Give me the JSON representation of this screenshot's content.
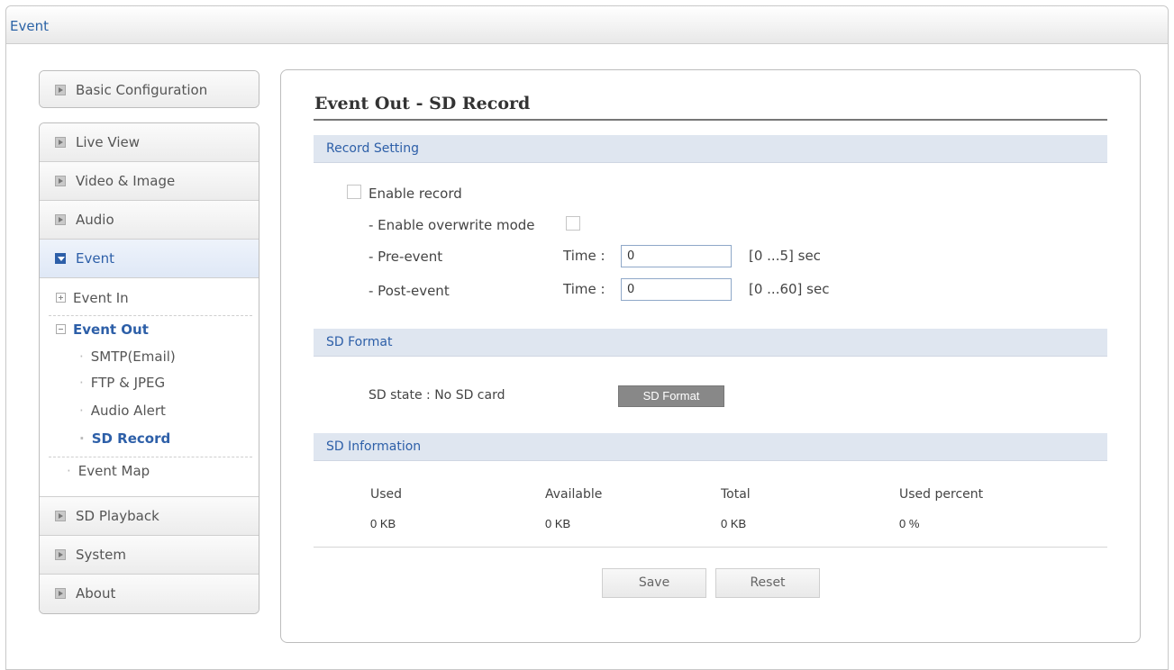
{
  "window": {
    "title": "Event"
  },
  "sidebar": {
    "top_item": "Basic Configuration",
    "items_before": [
      "Live View",
      "Video & Image",
      "Audio"
    ],
    "active_item": "Event",
    "submenu": {
      "event_in": "Event In",
      "event_out": "Event Out",
      "event_out_children": [
        "SMTP(Email)",
        "FTP & JPEG",
        "Audio Alert",
        "SD Record"
      ],
      "event_map": "Event Map"
    },
    "items_after": [
      "SD Playback",
      "System",
      "About"
    ]
  },
  "main": {
    "heading": "Event Out - SD Record",
    "record_setting": {
      "title": "Record Setting",
      "enable_record_label": "Enable record",
      "enable_record_checked": false,
      "overwrite_label": "- Enable overwrite mode",
      "overwrite_checked": false,
      "pre_event_label": "- Pre-event",
      "pre_event_time_label": "Time :",
      "pre_event_value": "0",
      "pre_event_range": "[0 ...5] sec",
      "post_event_label": "- Post-event",
      "post_event_time_label": "Time :",
      "post_event_value": "0",
      "post_event_range": "[0 ...60] sec"
    },
    "sd_format": {
      "title": "SD Format",
      "state_label": "SD state : No SD card",
      "format_button": "SD Format"
    },
    "sd_information": {
      "title": "SD Information",
      "columns": [
        "Used",
        "Available",
        "Total",
        "Used percent"
      ],
      "values": [
        "0 KB",
        "0 KB",
        "0 KB",
        "0 %"
      ]
    },
    "buttons": {
      "save": "Save",
      "reset": "Reset"
    }
  },
  "colors": {
    "accent": "#2d5fa8",
    "section_bg": "#dfe6f0",
    "dark_button": "#888888"
  }
}
